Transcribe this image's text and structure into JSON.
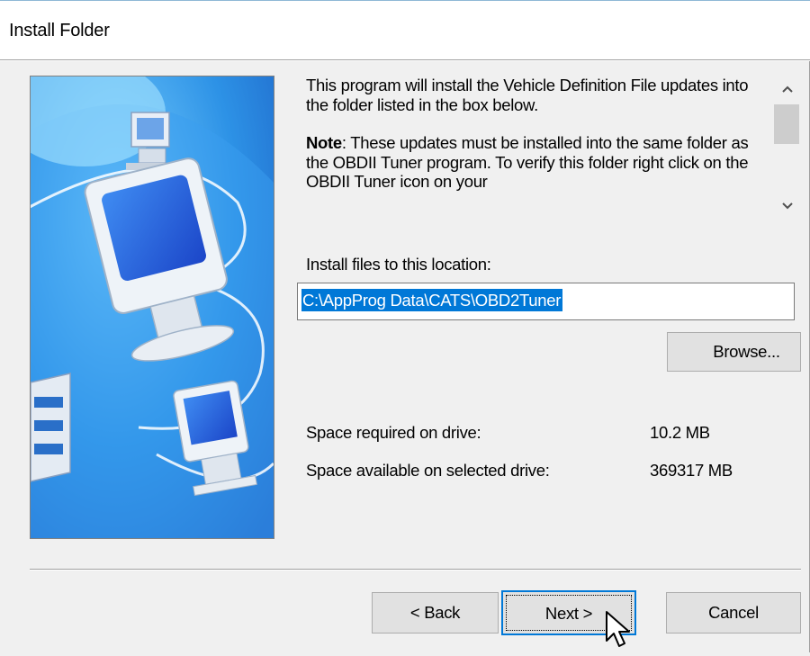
{
  "window": {
    "title": "Install Folder"
  },
  "info": {
    "paragraph1": "This program will install the Vehicle Definition File updates into the folder listed in the box below.",
    "note_label": "Note",
    "note_text": ": These updates must be installed into the same folder as the OBDII Tuner program. To verify this folder right click on the OBDII Tuner icon on your"
  },
  "location": {
    "label": "Install files to this location:",
    "value": "C:\\AppProg Data\\CATS\\OBD2Tuner"
  },
  "browse_label": "Browse...",
  "space": {
    "required_label": "Space required on drive:",
    "required_value": "10.2 MB",
    "available_label": "Space available on selected drive:",
    "available_value": "369317 MB"
  },
  "buttons": {
    "back": "< Back",
    "next": "Next >",
    "cancel": "Cancel"
  },
  "icons": {
    "scroll_up": "chevron-up-icon",
    "scroll_down": "chevron-down-icon",
    "cursor": "mouse-pointer-icon"
  },
  "colors": {
    "selection": "#0078d7",
    "dialog_bg": "#f0f0f0",
    "button_bg": "#e1e1e1",
    "illustration_blue": "#2b8ee0"
  }
}
